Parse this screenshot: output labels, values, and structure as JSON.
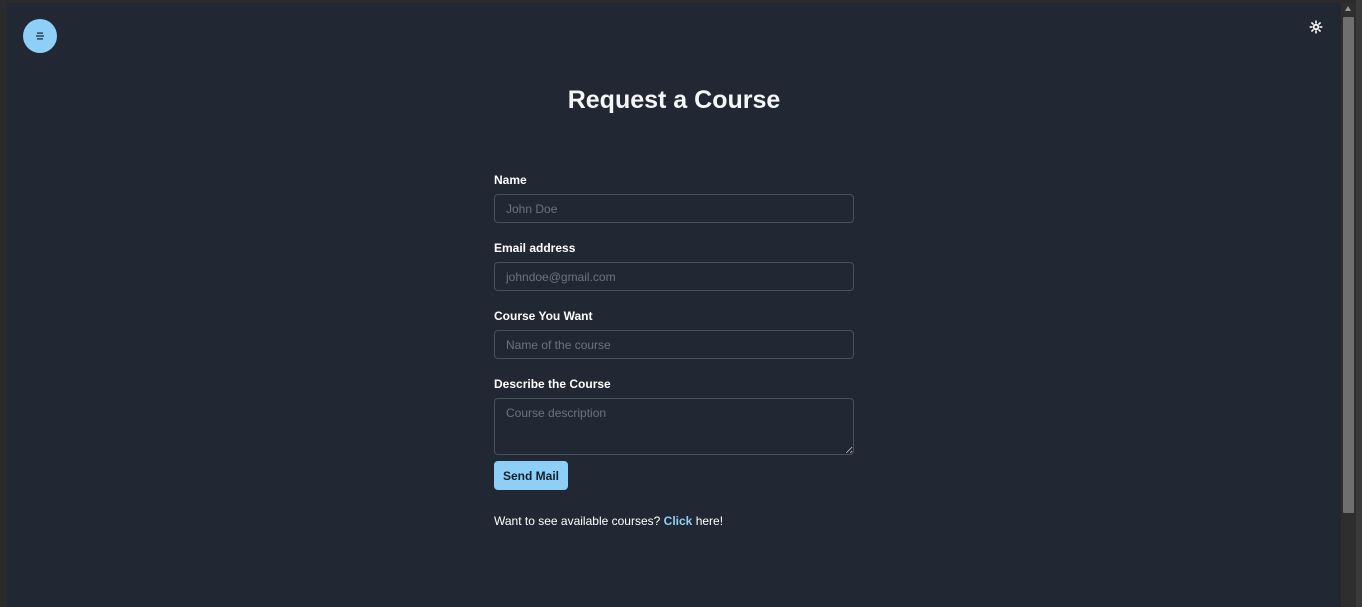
{
  "header": {
    "menu_icon": "menu-lines-icon",
    "theme_icon": "sun-gear-icon"
  },
  "page": {
    "title": "Request a Course"
  },
  "form": {
    "name_label": "Name",
    "name_placeholder": "John Doe",
    "name_value": "",
    "email_label": "Email address",
    "email_placeholder": "johndoe@gmail.com",
    "email_value": "",
    "course_label": "Course You Want",
    "course_placeholder": "Name of the course",
    "course_value": "",
    "description_label": "Describe the Course",
    "description_placeholder": "Course description",
    "description_value": "",
    "submit_label": "Send Mail"
  },
  "footer": {
    "prompt": "Want to see available courses?",
    "link_text": "Click",
    "suffix": "here!"
  },
  "colors": {
    "background": "#222833",
    "accent": "#8ecff7",
    "text": "#ffffff",
    "input_border": "#4a505c"
  }
}
